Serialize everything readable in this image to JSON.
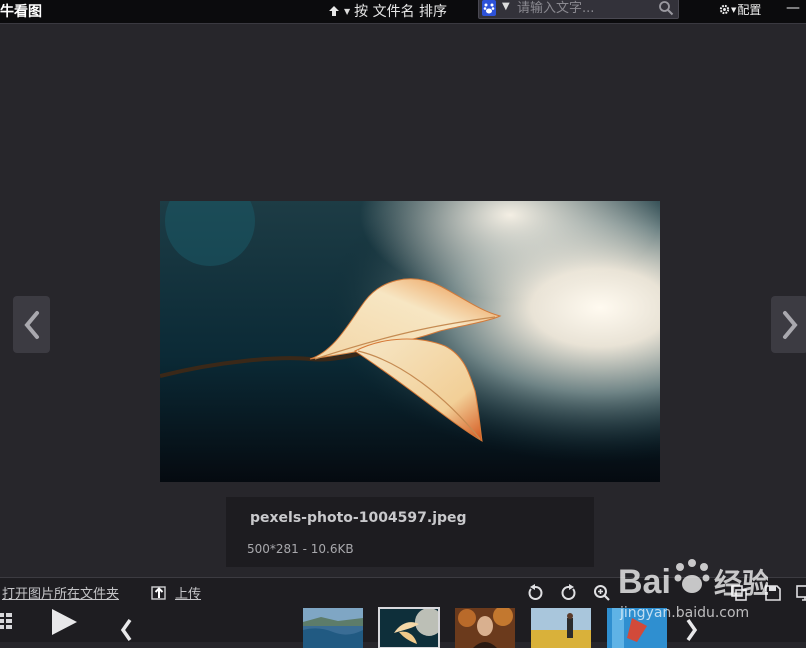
{
  "app": {
    "title": "看牛看图"
  },
  "toolbar": {
    "sort_label": "按 文件名 排序",
    "search_placeholder": "请输入文字...",
    "config_label": "配置",
    "minimize_label": "—"
  },
  "image": {
    "filename": "pexels-photo-1004597.jpeg",
    "info": "500*281  -  10.6KB"
  },
  "bottom": {
    "open_folder_label": "打开图片所在文件夹",
    "upload_label": "上传"
  },
  "thumbnails": [
    {
      "name": "sea-thumb",
      "active": false
    },
    {
      "name": "leaf-thumb",
      "active": true
    },
    {
      "name": "portrait-thumb",
      "active": false
    },
    {
      "name": "field-thumb",
      "active": false
    },
    {
      "name": "pool-thumb",
      "active": false
    }
  ],
  "watermark": {
    "brand": "Baidu经验",
    "url": "jingyan.baidu.com"
  },
  "colors": {
    "background": "#27262b",
    "topbar": "#0b0b0d",
    "accent_blue": "#2d52d8"
  }
}
